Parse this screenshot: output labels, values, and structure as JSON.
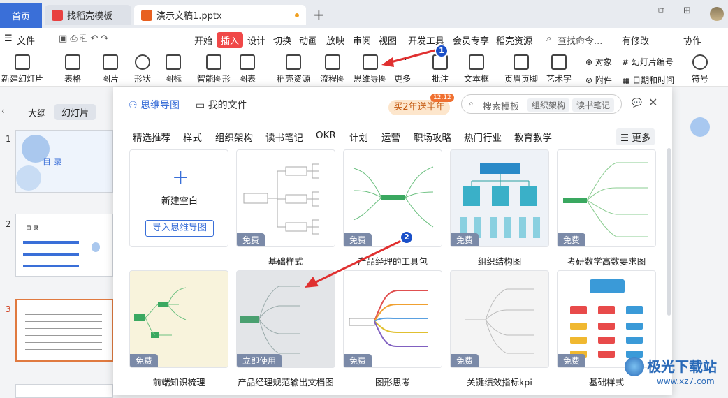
{
  "tabs": {
    "home": "首页",
    "template": "找稻壳模板",
    "doc": "演示文稿1.pptx"
  },
  "menubar": {
    "file": "文件",
    "items": [
      "开始",
      "插入",
      "设计",
      "切换",
      "动画",
      "放映",
      "审阅",
      "视图",
      "开发工具",
      "会员专享",
      "稻壳资源"
    ],
    "search": "查找命令...",
    "changes": "有修改",
    "collab": "协作"
  },
  "ribbon": {
    "new_slide": "新建幻灯片",
    "table": "表格",
    "image": "图片",
    "shape": "形状",
    "icon": "图标",
    "smart": "智能图形",
    "chart": "图表",
    "daoke": "稻壳资源",
    "flow": "流程图",
    "mindmap": "思维导图",
    "more": "更多",
    "comment": "批注",
    "textbox": "文本框",
    "header_footer": "页眉页脚",
    "wordart": "艺术字",
    "object": "对象",
    "slide_no": "幻灯片编号",
    "attach": "附件",
    "datetime": "日期和时间",
    "symbol": "符号"
  },
  "left_panel": {
    "outline": "大纲",
    "slides": "幻灯片",
    "nums": [
      "1",
      "2",
      "3"
    ]
  },
  "dialog": {
    "mindmap_tab": "思维导图",
    "myfiles_tab": "我的文件",
    "promo": "买2年送半年",
    "promo_badge": "12.12",
    "search_ph": "搜索模板",
    "tag1": "组织架构",
    "tag2": "读书笔记",
    "categories": [
      "精选推荐",
      "样式",
      "组织架构",
      "读书笔记",
      "OKR",
      "计划",
      "运营",
      "职场攻略",
      "热门行业",
      "教育教学"
    ],
    "more": "更多",
    "blank": "新建空白",
    "import": "导入思维导图",
    "row1": [
      {
        "title": "基础样式",
        "badge": "免费"
      },
      {
        "title": "产品经理的工具包",
        "badge": "免费"
      },
      {
        "title": "组织结构图",
        "badge": "免费"
      },
      {
        "title": "考研数学高数要求图",
        "badge": "免费"
      }
    ],
    "row2": [
      {
        "title": "前端知识梳理",
        "badge": "免费"
      },
      {
        "title": "产品经理规范输出文档图",
        "badge": "立即使用"
      },
      {
        "title": "图形思考",
        "badge": "免费"
      },
      {
        "title": "关键绩效指标kpi",
        "badge": "免费"
      },
      {
        "title": "基础样式",
        "badge": "免费"
      }
    ]
  },
  "slide1": {
    "title": "目 录"
  },
  "slide2": {
    "title": "目 录"
  },
  "steps": [
    "1",
    "2"
  ],
  "watermark": {
    "text": "极光下载站",
    "sub": "www.xz7.com"
  },
  "colors": {
    "accent": "#3a6fd8",
    "insert": "#f04848",
    "arrow": "#e03030"
  }
}
